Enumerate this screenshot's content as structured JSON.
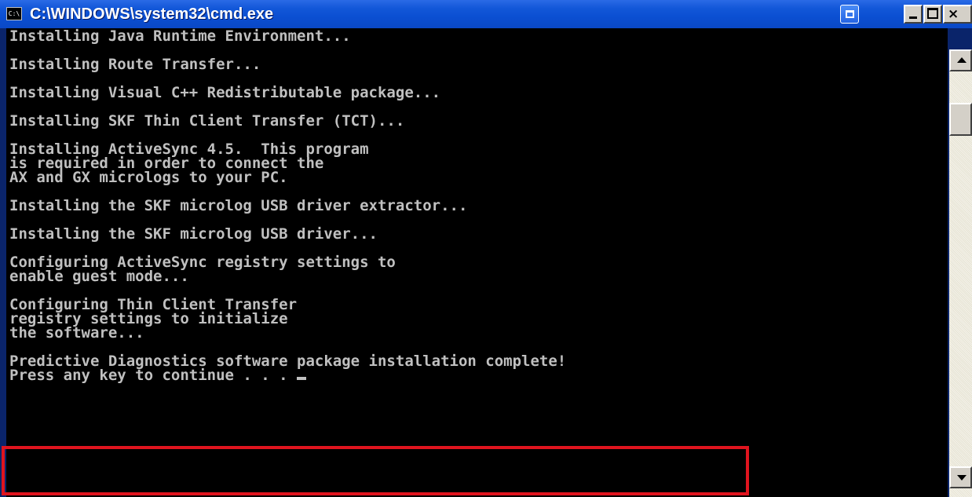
{
  "window": {
    "title": "C:\\WINDOWS\\system32\\cmd.exe",
    "icon_label": "C:\\",
    "icon": "cmd-console-icon"
  },
  "titlebar_buttons": {
    "restore": "restore-icon",
    "minimize": "minimize-icon",
    "maximize": "maximize-icon",
    "close_glyph": "×"
  },
  "console": {
    "blocks": [
      {
        "lines": [
          "Installing Java Runtime Environment..."
        ]
      },
      {
        "lines": [
          "Installing Route Transfer..."
        ]
      },
      {
        "lines": [
          "Installing Visual C++ Redistributable package..."
        ]
      },
      {
        "lines": [
          "Installing SKF Thin Client Transfer (TCT)..."
        ]
      },
      {
        "lines": [
          "Installing ActiveSync 4.5.  This program",
          "is required in order to connect the",
          "AX and GX micrologs to your PC."
        ]
      },
      {
        "lines": [
          "Installing the SKF microlog USB driver extractor..."
        ]
      },
      {
        "lines": [
          "Installing the SKF microlog USB driver..."
        ]
      },
      {
        "lines": [
          "Configuring ActiveSync registry settings to",
          "enable guest mode..."
        ]
      },
      {
        "lines": [
          "Configuring Thin Client Transfer",
          "registry settings to initialize",
          "the software..."
        ]
      }
    ],
    "final_line_1": "Predictive Diagnostics software package installation complete!",
    "final_line_2": "Press any key to continue . . . "
  },
  "colors": {
    "console_bg": "#000000",
    "console_text": "#c0c0c0",
    "titlebar": "#0b4fd2",
    "highlight": "#e0141e"
  }
}
